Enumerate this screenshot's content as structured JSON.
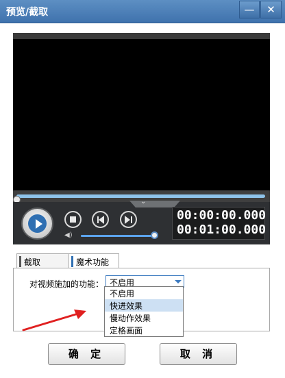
{
  "window": {
    "title": "预览/截取",
    "minimize_glyph": "—",
    "close_glyph": "✕"
  },
  "player": {
    "progress": 0.0,
    "volume": 1.0,
    "current_time": "00:00:00.000",
    "total_time": "00:01:00.000",
    "icons": [
      "chevron-down-icon",
      "play-icon",
      "stop-icon",
      "previous-frame-icon",
      "next-frame-icon",
      "volume-icon"
    ]
  },
  "tabs": [
    {
      "label": "截取",
      "active": false
    },
    {
      "label": "魔术功能",
      "active": true
    }
  ],
  "magic": {
    "label": "对视频施加的功能：",
    "selected": "不启用",
    "options": [
      "不启用",
      "快进效果",
      "慢动作效果",
      "定格画面"
    ],
    "highlighted_index": 1
  },
  "buttons": {
    "ok": "确 定",
    "cancel": "取 消"
  },
  "colors": {
    "title_bar": "#4a7db8",
    "accent": "#2f6fb2",
    "annotation_arrow": "#e02020"
  }
}
